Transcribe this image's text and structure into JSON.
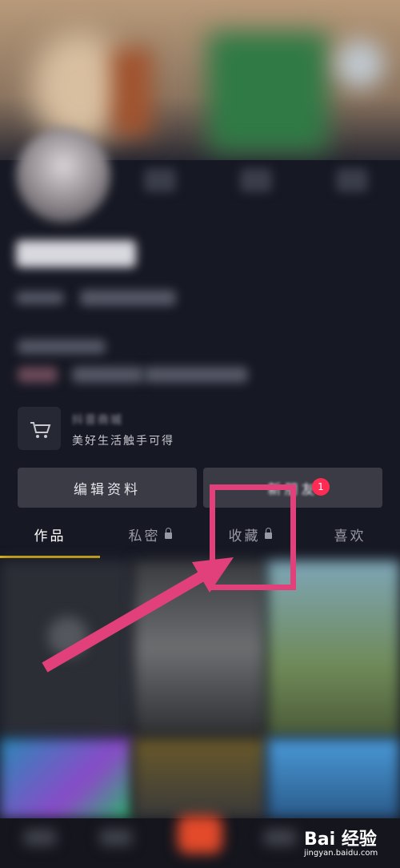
{
  "shop": {
    "title": "抖音商城",
    "desc": "美好生活触手可得"
  },
  "buttons": {
    "edit_label": "编辑资料",
    "friend_label": "新朋友",
    "friend_badge": "1"
  },
  "tabs": [
    {
      "label": "作品"
    },
    {
      "label": "私密"
    },
    {
      "label": "收藏"
    },
    {
      "label": "喜欢"
    }
  ],
  "watermark": {
    "brand": "Bai 经验",
    "url": "jingyan.baidu.com"
  },
  "colors": {
    "accent": "#f2c316",
    "annotation": "#e2407a",
    "badge": "#fe2c55"
  }
}
